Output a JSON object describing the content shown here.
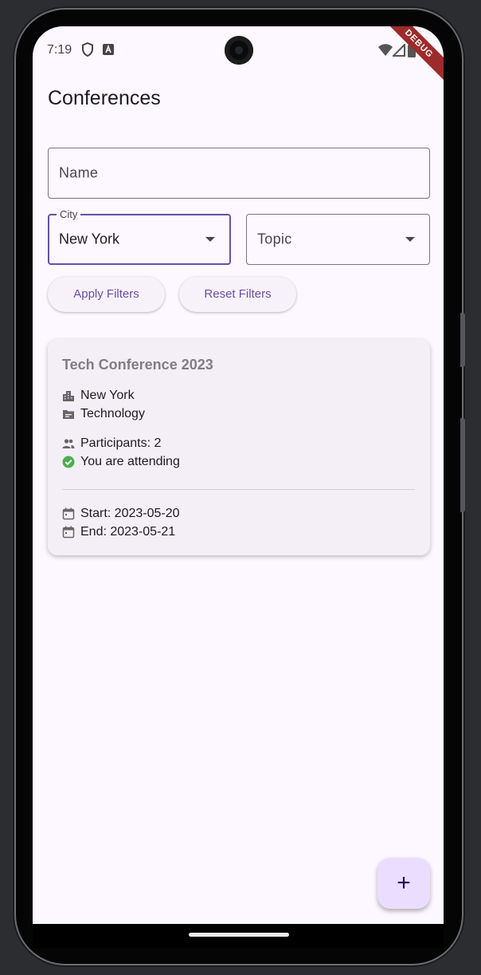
{
  "status_bar": {
    "time": "7:19"
  },
  "debug_banner": "DEBUG",
  "app": {
    "title": "Conferences"
  },
  "filters": {
    "name_placeholder": "Name",
    "city_label": "City",
    "city_value": "New York",
    "topic_placeholder": "Topic",
    "apply_label": "Apply Filters",
    "reset_label": "Reset Filters"
  },
  "conference": {
    "title": "Tech Conference 2023",
    "city": "New York",
    "topic": "Technology",
    "participants": "Participants: 2",
    "attending": "You are attending",
    "start": "Start: 2023-05-20",
    "end": "End: 2023-05-21"
  },
  "fab": {
    "icon": "+"
  },
  "colors": {
    "primary": "#6750a4",
    "background": "#fdf7ff",
    "card": "#f4eff6",
    "attending_check": "#4caf50"
  }
}
